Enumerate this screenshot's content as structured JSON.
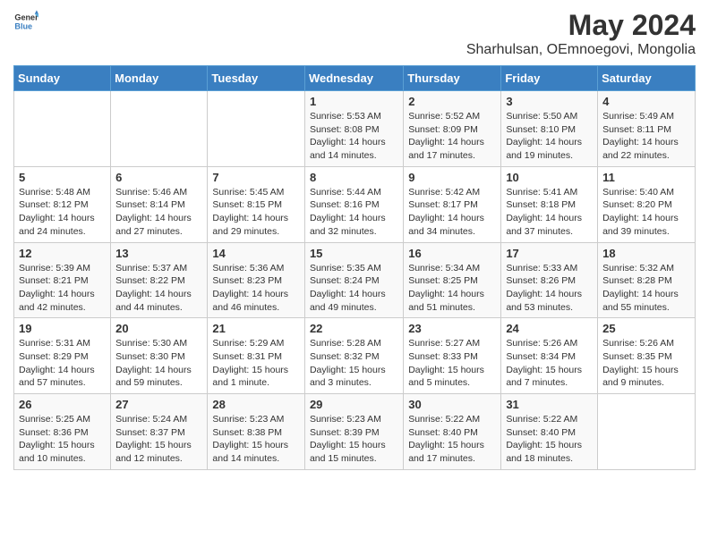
{
  "header": {
    "logo_general": "General",
    "logo_blue": "Blue",
    "month_year": "May 2024",
    "location": "Sharhulsan, OEmnoegovi, Mongolia"
  },
  "days_of_week": [
    "Sunday",
    "Monday",
    "Tuesday",
    "Wednesday",
    "Thursday",
    "Friday",
    "Saturday"
  ],
  "weeks": [
    [
      {
        "day": "",
        "info": ""
      },
      {
        "day": "",
        "info": ""
      },
      {
        "day": "",
        "info": ""
      },
      {
        "day": "1",
        "info": "Sunrise: 5:53 AM\nSunset: 8:08 PM\nDaylight: 14 hours and 14 minutes."
      },
      {
        "day": "2",
        "info": "Sunrise: 5:52 AM\nSunset: 8:09 PM\nDaylight: 14 hours and 17 minutes."
      },
      {
        "day": "3",
        "info": "Sunrise: 5:50 AM\nSunset: 8:10 PM\nDaylight: 14 hours and 19 minutes."
      },
      {
        "day": "4",
        "info": "Sunrise: 5:49 AM\nSunset: 8:11 PM\nDaylight: 14 hours and 22 minutes."
      }
    ],
    [
      {
        "day": "5",
        "info": "Sunrise: 5:48 AM\nSunset: 8:12 PM\nDaylight: 14 hours and 24 minutes."
      },
      {
        "day": "6",
        "info": "Sunrise: 5:46 AM\nSunset: 8:14 PM\nDaylight: 14 hours and 27 minutes."
      },
      {
        "day": "7",
        "info": "Sunrise: 5:45 AM\nSunset: 8:15 PM\nDaylight: 14 hours and 29 minutes."
      },
      {
        "day": "8",
        "info": "Sunrise: 5:44 AM\nSunset: 8:16 PM\nDaylight: 14 hours and 32 minutes."
      },
      {
        "day": "9",
        "info": "Sunrise: 5:42 AM\nSunset: 8:17 PM\nDaylight: 14 hours and 34 minutes."
      },
      {
        "day": "10",
        "info": "Sunrise: 5:41 AM\nSunset: 8:18 PM\nDaylight: 14 hours and 37 minutes."
      },
      {
        "day": "11",
        "info": "Sunrise: 5:40 AM\nSunset: 8:20 PM\nDaylight: 14 hours and 39 minutes."
      }
    ],
    [
      {
        "day": "12",
        "info": "Sunrise: 5:39 AM\nSunset: 8:21 PM\nDaylight: 14 hours and 42 minutes."
      },
      {
        "day": "13",
        "info": "Sunrise: 5:37 AM\nSunset: 8:22 PM\nDaylight: 14 hours and 44 minutes."
      },
      {
        "day": "14",
        "info": "Sunrise: 5:36 AM\nSunset: 8:23 PM\nDaylight: 14 hours and 46 minutes."
      },
      {
        "day": "15",
        "info": "Sunrise: 5:35 AM\nSunset: 8:24 PM\nDaylight: 14 hours and 49 minutes."
      },
      {
        "day": "16",
        "info": "Sunrise: 5:34 AM\nSunset: 8:25 PM\nDaylight: 14 hours and 51 minutes."
      },
      {
        "day": "17",
        "info": "Sunrise: 5:33 AM\nSunset: 8:26 PM\nDaylight: 14 hours and 53 minutes."
      },
      {
        "day": "18",
        "info": "Sunrise: 5:32 AM\nSunset: 8:28 PM\nDaylight: 14 hours and 55 minutes."
      }
    ],
    [
      {
        "day": "19",
        "info": "Sunrise: 5:31 AM\nSunset: 8:29 PM\nDaylight: 14 hours and 57 minutes."
      },
      {
        "day": "20",
        "info": "Sunrise: 5:30 AM\nSunset: 8:30 PM\nDaylight: 14 hours and 59 minutes."
      },
      {
        "day": "21",
        "info": "Sunrise: 5:29 AM\nSunset: 8:31 PM\nDaylight: 15 hours and 1 minute."
      },
      {
        "day": "22",
        "info": "Sunrise: 5:28 AM\nSunset: 8:32 PM\nDaylight: 15 hours and 3 minutes."
      },
      {
        "day": "23",
        "info": "Sunrise: 5:27 AM\nSunset: 8:33 PM\nDaylight: 15 hours and 5 minutes."
      },
      {
        "day": "24",
        "info": "Sunrise: 5:26 AM\nSunset: 8:34 PM\nDaylight: 15 hours and 7 minutes."
      },
      {
        "day": "25",
        "info": "Sunrise: 5:26 AM\nSunset: 8:35 PM\nDaylight: 15 hours and 9 minutes."
      }
    ],
    [
      {
        "day": "26",
        "info": "Sunrise: 5:25 AM\nSunset: 8:36 PM\nDaylight: 15 hours and 10 minutes."
      },
      {
        "day": "27",
        "info": "Sunrise: 5:24 AM\nSunset: 8:37 PM\nDaylight: 15 hours and 12 minutes."
      },
      {
        "day": "28",
        "info": "Sunrise: 5:23 AM\nSunset: 8:38 PM\nDaylight: 15 hours and 14 minutes."
      },
      {
        "day": "29",
        "info": "Sunrise: 5:23 AM\nSunset: 8:39 PM\nDaylight: 15 hours and 15 minutes."
      },
      {
        "day": "30",
        "info": "Sunrise: 5:22 AM\nSunset: 8:40 PM\nDaylight: 15 hours and 17 minutes."
      },
      {
        "day": "31",
        "info": "Sunrise: 5:22 AM\nSunset: 8:40 PM\nDaylight: 15 hours and 18 minutes."
      },
      {
        "day": "",
        "info": ""
      }
    ]
  ]
}
